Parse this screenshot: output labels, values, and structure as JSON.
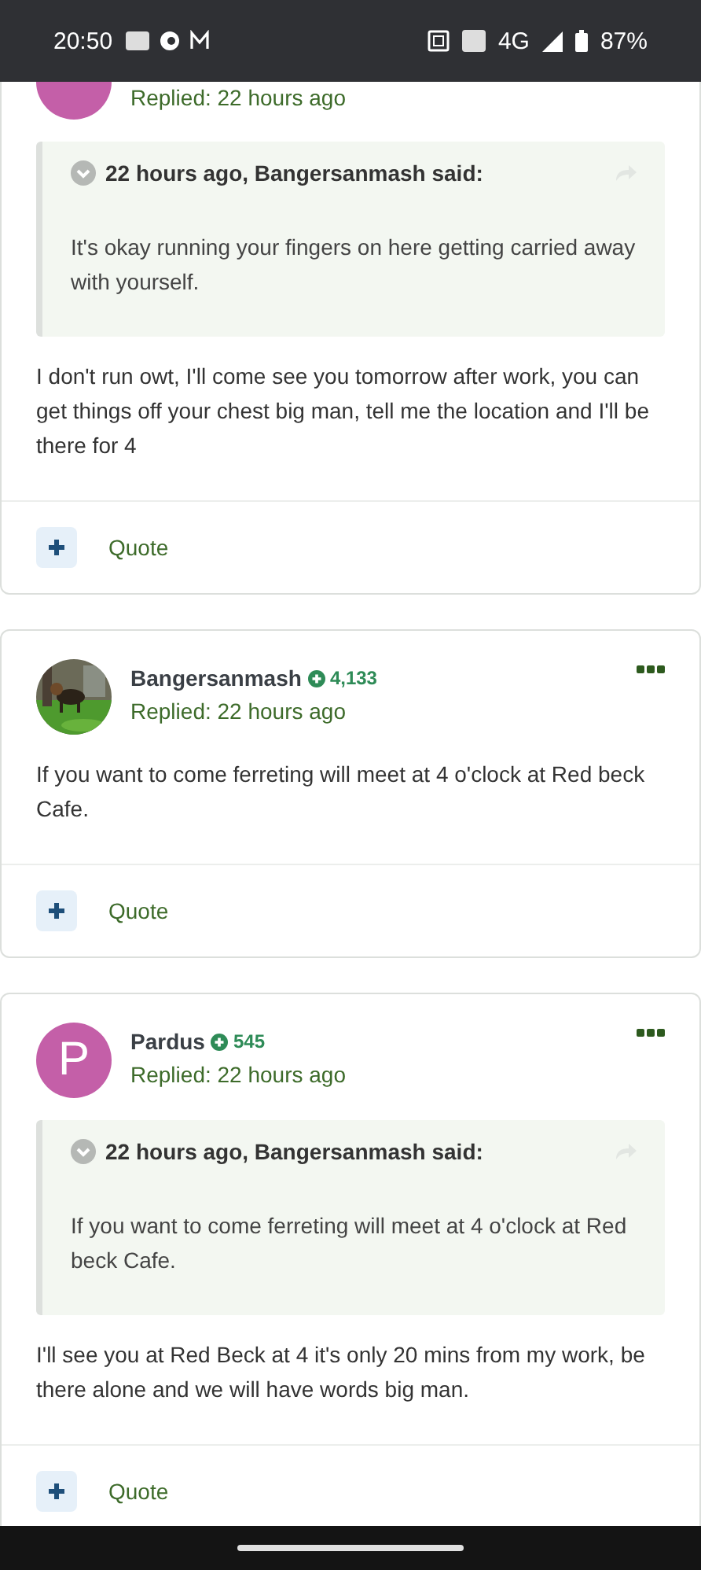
{
  "status_bar": {
    "time": "20:50",
    "network": "4G",
    "battery": "87%"
  },
  "posts": [
    {
      "avatar": {
        "kind": "letter",
        "color": "#c45fa8"
      },
      "replied": "Replied: 22 hours ago",
      "quote": {
        "header": "22 hours ago, Bangersanmash said:",
        "text": "It's okay running your fingers on here getting carried away with yourself."
      },
      "body": "I don't run owt, I'll come see you tomorrow after work, you can get things off your chest big man, tell me the location and I'll be there for 4",
      "action": "Quote"
    },
    {
      "author": "Bangersanmash",
      "reputation": "4,133",
      "replied": "Replied: 22 hours ago",
      "body": "If you want to come ferreting will meet at  4 o'clock at Red beck Cafe.",
      "action": "Quote"
    },
    {
      "avatar": {
        "kind": "letter",
        "letter": "P",
        "color": "#c45fa8"
      },
      "author": "Pardus",
      "reputation": "545",
      "replied": "Replied: 22 hours ago",
      "quote": {
        "header": "22 hours ago, Bangersanmash said:",
        "text": "If you want to come ferreting will meet at  4 o'clock at Red beck Cafe."
      },
      "body": "I'll see you at Red Beck at 4 it's only 20 mins from my work, be there alone and we will have words big man.",
      "action": "Quote"
    }
  ]
}
